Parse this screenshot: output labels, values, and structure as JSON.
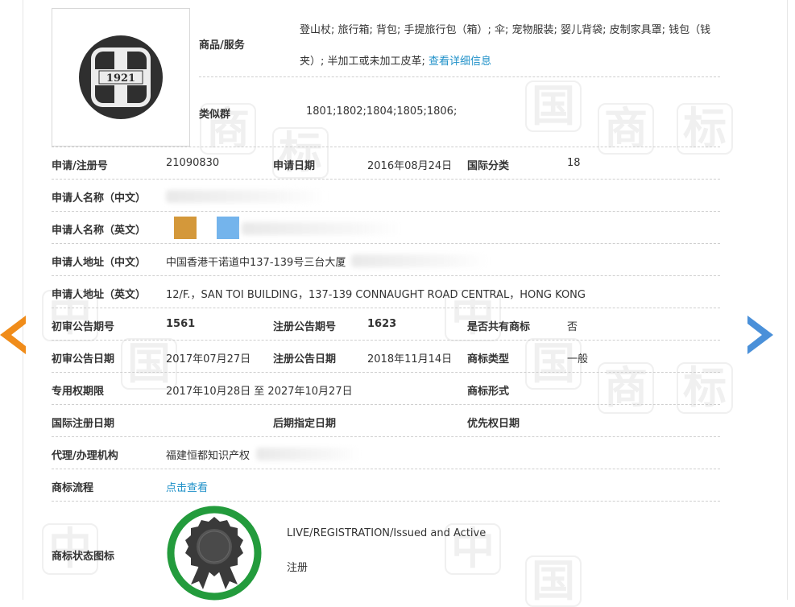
{
  "goods": {
    "label": "商品/服务",
    "text": "登山杖; 旅行箱; 背包; 手提旅行包（箱）; 伞; 宠物服装; 婴儿背袋; 皮制家具罩; 钱包（钱夹）; 半加工或未加工皮革;",
    "detail_link": "查看详细信息"
  },
  "similar_group": {
    "label": "类似群",
    "value": "1801;1802;1804;1805;1806;"
  },
  "logo": {
    "text": "1921"
  },
  "fields": {
    "reg_no": {
      "label": "申请/注册号",
      "value": "21090830"
    },
    "app_date": {
      "label": "申请日期",
      "value": "2016年08月24日"
    },
    "intl_class": {
      "label": "国际分类",
      "value": "18"
    },
    "applicant_cn": {
      "label": "申请人名称（中文）"
    },
    "applicant_en": {
      "label": "申请人名称（英文）"
    },
    "address_cn": {
      "label": "申请人地址（中文）",
      "value": "中国香港干诺道中137-139号三台大厦"
    },
    "address_en": {
      "label": "申请人地址（英文）",
      "value": "12/F.，SAN TOI BUILDING，137-139 CONNAUGHT ROAD CENTRAL，HONG KONG"
    },
    "prelim_issue": {
      "label": "初审公告期号",
      "value": "1561"
    },
    "reg_issue": {
      "label": "注册公告期号",
      "value": "1623"
    },
    "shared": {
      "label": "是否共有商标",
      "value": "否"
    },
    "prelim_date": {
      "label": "初审公告日期",
      "value": "2017年07月27日"
    },
    "reg_date": {
      "label": "注册公告日期",
      "value": "2018年11月14日"
    },
    "tm_type": {
      "label": "商标类型",
      "value": "一般"
    },
    "exclusive_period": {
      "label": "专用权期限",
      "value": "2017年10月28日 至 2027年10月27日"
    },
    "tm_form": {
      "label": "商标形式",
      "value": ""
    },
    "intl_reg_date": {
      "label": "国际注册日期",
      "value": ""
    },
    "later_designation": {
      "label": "后期指定日期",
      "value": ""
    },
    "priority_date": {
      "label": "优先权日期",
      "value": ""
    },
    "agent": {
      "label": "代理/办理机构",
      "value": "福建恒都知识产权"
    },
    "process": {
      "label": "商标流程",
      "link": "点击查看"
    },
    "status_icon": {
      "label": "商标状态图标"
    }
  },
  "status": {
    "en": "LIVE/REGISTRATION/Issued and Active",
    "cn": "注册"
  },
  "watermark": [
    "中",
    "国",
    "商",
    "标"
  ],
  "colors": {
    "link": "#1e90c8",
    "arrow_left": "#f08c1a",
    "arrow_right": "#4a90d9",
    "badge_ring": "#239b3c",
    "swatch_1": "#d4983a",
    "swatch_2": "#74b4ec"
  },
  "icons": {
    "prev": "arrow-left-icon",
    "next": "arrow-right-icon",
    "status": "award-ribbon-icon"
  }
}
